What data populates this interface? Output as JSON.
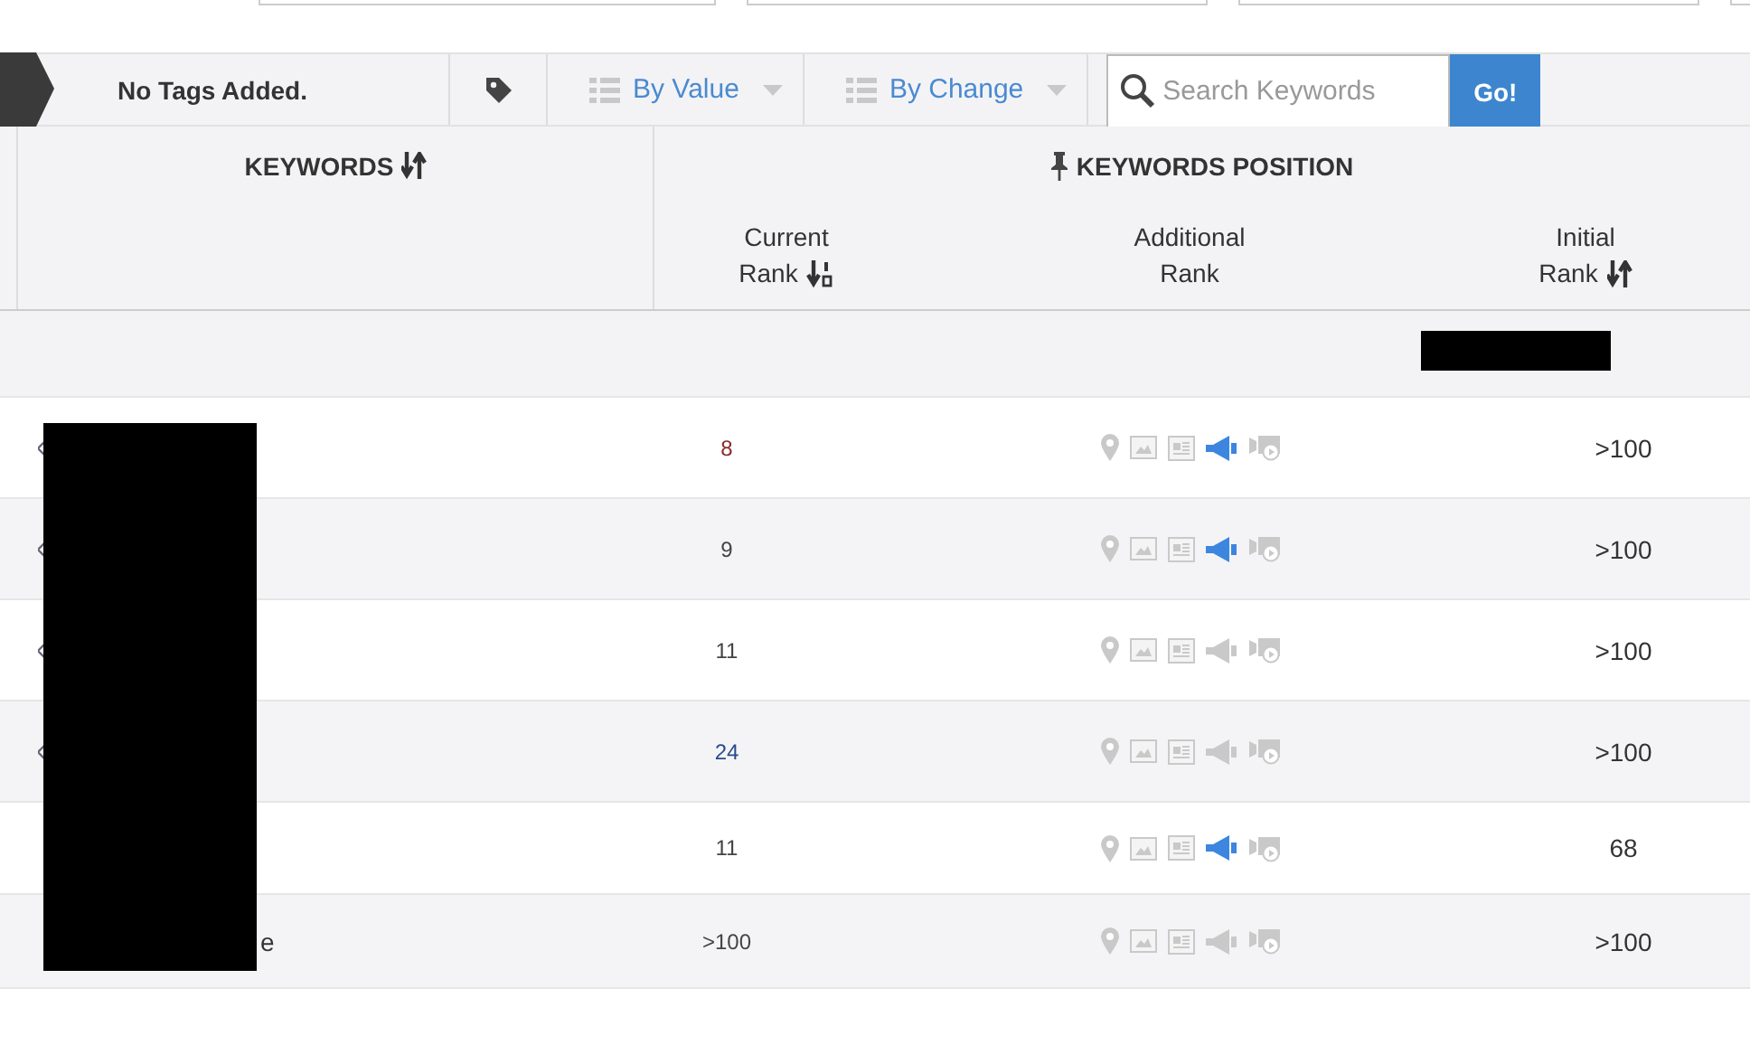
{
  "toolbar": {
    "tags_label": "No Tags Added.",
    "filters": [
      {
        "label": "By Value"
      },
      {
        "label": "By Change"
      }
    ],
    "search": {
      "placeholder": "Search Keywords"
    },
    "go_button": "Go!"
  },
  "header": {
    "keywords": "KEYWORDS",
    "position": "KEYWORDS POSITION",
    "columns": [
      {
        "kind": "sorted",
        "line1": "Current",
        "line2": "Rank"
      },
      {
        "kind": "plain",
        "line1": "Additional",
        "line2": "Rank"
      },
      {
        "kind": "sortable",
        "line1": "Initial",
        "line2": "Rank"
      }
    ]
  },
  "rows": [
    {
      "keyword": "",
      "tagged": true,
      "current_rank": "8",
      "color": "#8b2a2a",
      "ads": true,
      "initial_rank": ">100"
    },
    {
      "keyword": "",
      "tagged": true,
      "current_rank": "9",
      "color": "#444444",
      "ads": true,
      "initial_rank": ">100"
    },
    {
      "keyword": "",
      "tagged": true,
      "current_rank": "11",
      "color": "#444444",
      "ads": false,
      "initial_rank": ">100"
    },
    {
      "keyword": "",
      "tagged": true,
      "current_rank": "24",
      "color": "#2a4a8b",
      "ads": false,
      "initial_rank": ">100"
    },
    {
      "keyword": "",
      "tagged": false,
      "current_rank": "11",
      "color": "#444444",
      "ads": true,
      "initial_rank": "68"
    },
    {
      "keyword": "e",
      "tagged": false,
      "current_rank": ">100",
      "color": "#444444",
      "ads": false,
      "initial_rank": ">100"
    }
  ]
}
